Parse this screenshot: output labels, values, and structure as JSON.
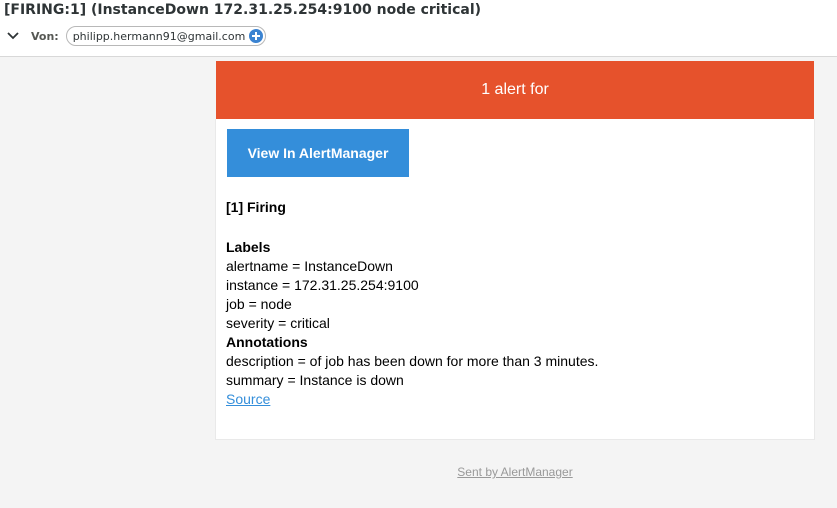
{
  "header": {
    "subject": "[FIRING:1] (InstanceDown 172.31.25.254:9100 node critical)",
    "from_label": "Von:",
    "from_address": "philipp.hermann91@gmail.com"
  },
  "email": {
    "banner": "1 alert for",
    "button_label": "View In AlertManager",
    "firing_heading": "[1] Firing",
    "labels_heading": "Labels",
    "labels": [
      "alertname = InstanceDown",
      "instance = 172.31.25.254:9100",
      "job = node",
      "severity = critical"
    ],
    "annotations_heading": "Annotations",
    "annotations": [
      "description = of job has been down for more than 3 minutes.",
      "summary = Instance is down"
    ],
    "source_link": "Source",
    "footer": "Sent by AlertManager"
  },
  "colors": {
    "banner": "#e6522c",
    "button": "#348eda",
    "link": "#348eda"
  },
  "icons": {
    "expand": "chevron-down-icon",
    "add_contact": "add-contact-icon"
  }
}
